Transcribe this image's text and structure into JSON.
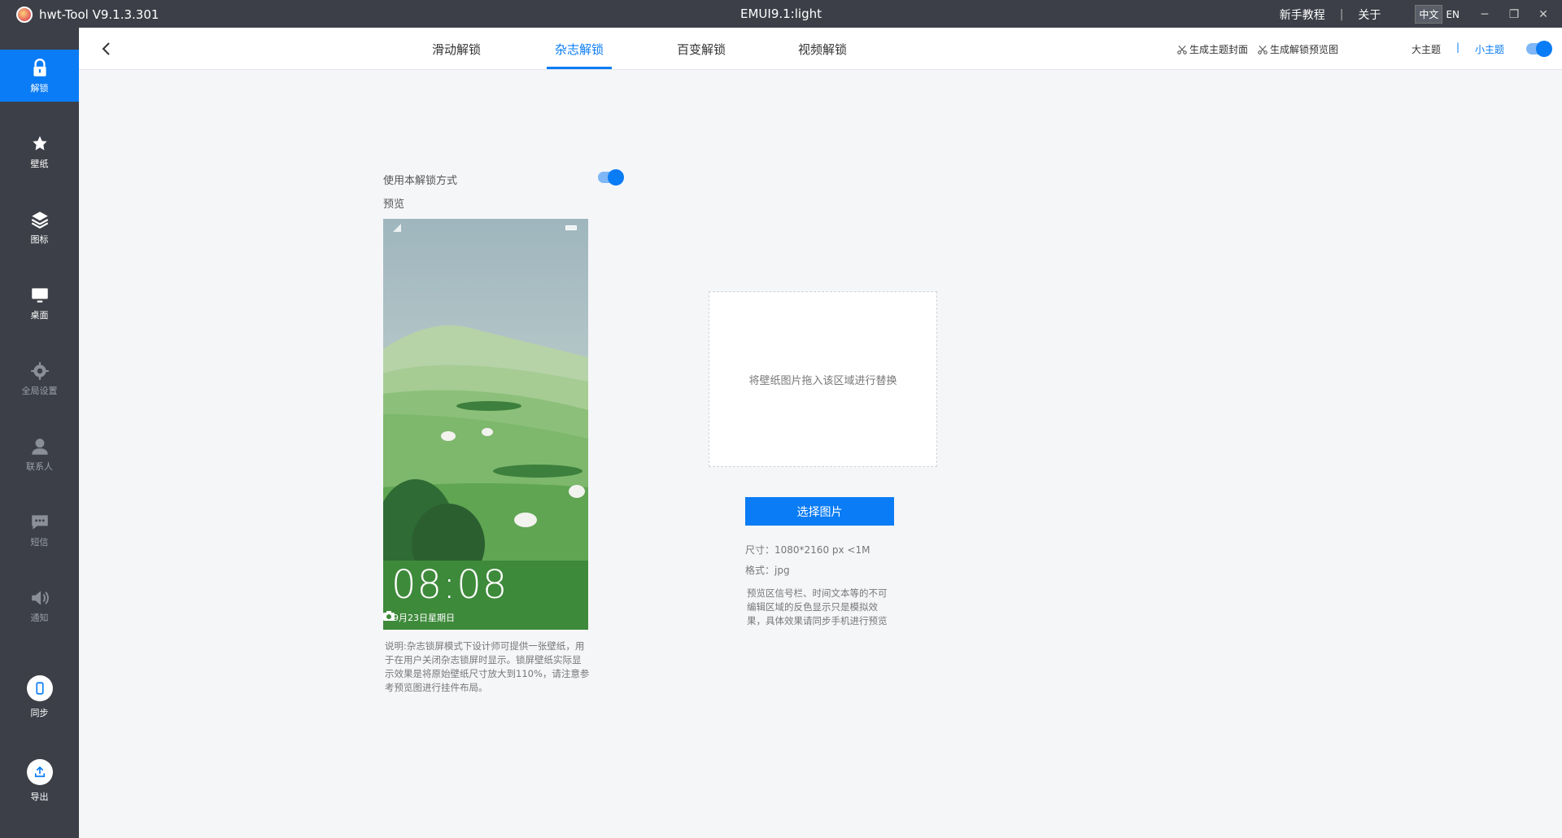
{
  "window": {
    "app_name": "hwt-Tool V9.1.3.301",
    "center_title": "EMUI9.1:light",
    "tutorial": "新手教程",
    "separator": "|",
    "about": "关于",
    "lang_zh": "中文",
    "lang_en": "EN"
  },
  "sidebar": {
    "items": [
      {
        "label": "解锁",
        "icon": "lock-icon",
        "active": true
      },
      {
        "label": "壁纸",
        "icon": "wallpaper-icon"
      },
      {
        "label": "图标",
        "icon": "layers-icon"
      },
      {
        "label": "桌面",
        "icon": "monitor-icon"
      },
      {
        "label": "全局设置",
        "icon": "gear-icon"
      },
      {
        "label": "联系人",
        "icon": "person-icon"
      },
      {
        "label": "短信",
        "icon": "chat-icon"
      },
      {
        "label": "通知",
        "icon": "speaker-icon"
      }
    ],
    "sync": {
      "label": "同步",
      "icon": "phone-icon"
    },
    "export": {
      "label": "导出",
      "icon": "upload-icon"
    }
  },
  "tabs": {
    "items": [
      "滑动解锁",
      "杂志解锁",
      "百变解锁",
      "视频解锁"
    ],
    "active_index": 1
  },
  "toolbar": {
    "gen_cover": "生成主题封面",
    "gen_preview": "生成解锁预览图",
    "big_theme": "大主题",
    "sep": "|",
    "small_theme": "小主题",
    "small_theme_on": true
  },
  "main": {
    "use_mode_label": "使用本解锁方式",
    "use_mode_on": true,
    "preview_label": "预览",
    "phone_time": "08:08",
    "phone_date": "9月23日星期日",
    "note": "说明:杂志锁屏模式下设计师可提供一张壁纸，用于在用户关闭杂志锁屏时显示。锁屏壁纸实际显示效果是将原始壁纸尺寸放大到110%，请注意参考预览图进行挂件布局。",
    "dropzone_text": "将壁纸图片拖入该区域进行替换",
    "select_button": "选择图片",
    "size_info": "尺寸：1080*2160 px  <1M",
    "format_info": "格式：jpg",
    "hint": "预览区信号栏、时间文本等的不可编辑区域的反色显示只是模拟效果，具体效果请同步手机进行预览"
  },
  "colors": {
    "accent": "#0a7cf5",
    "sidebar_bg": "#3c3f47",
    "content_bg": "#f5f6f8"
  }
}
